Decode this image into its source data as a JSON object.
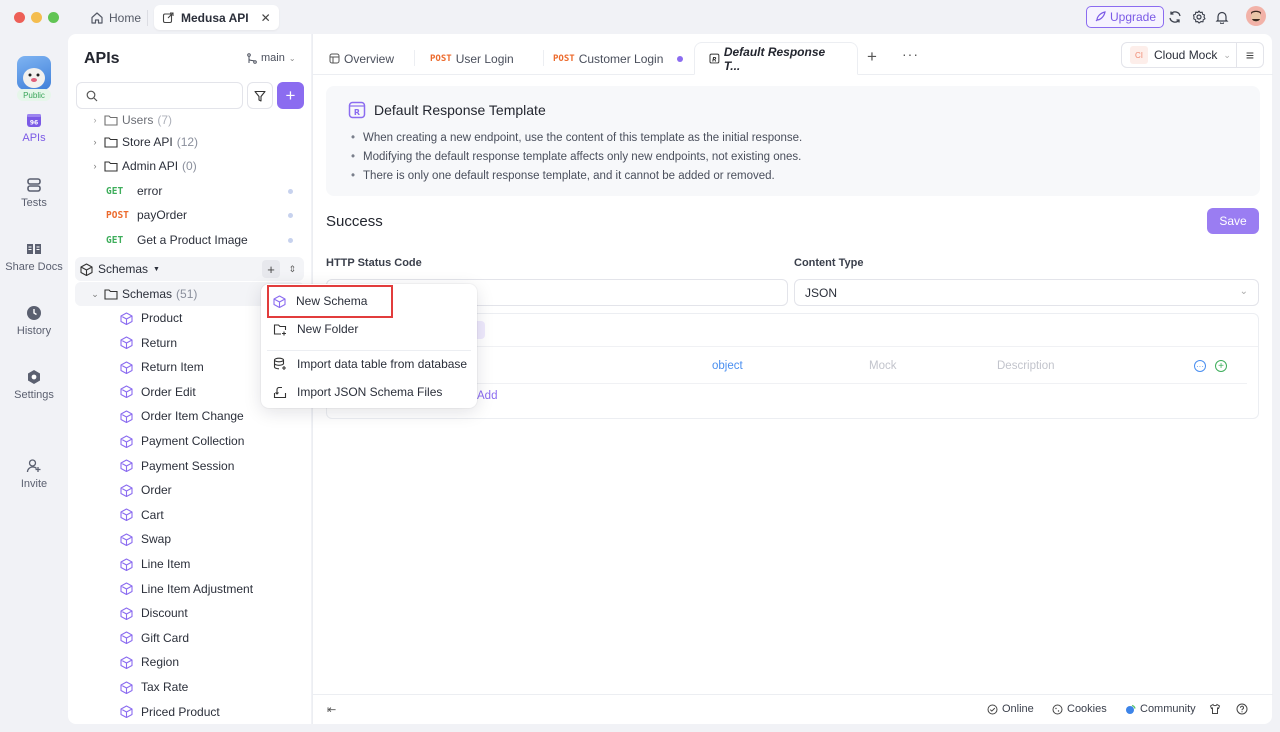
{
  "titlebar": {
    "home_label": "Home",
    "project_tab_label": "Medusa API",
    "upgrade_label": "Upgrade"
  },
  "rail": {
    "public_badge": "Public",
    "items": [
      {
        "label": "APIs",
        "icon": "apis-icon",
        "active": true
      },
      {
        "label": "Tests",
        "icon": "tests-icon"
      },
      {
        "label": "Share Docs",
        "icon": "share-docs-icon"
      },
      {
        "label": "History",
        "icon": "history-icon"
      },
      {
        "label": "Settings",
        "icon": "settings-icon"
      },
      {
        "label": "Invite",
        "icon": "invite-icon"
      }
    ]
  },
  "sidebar": {
    "title": "APIs",
    "branch": "main",
    "search_placeholder": "",
    "tree": [
      {
        "type": "folder",
        "label": "Users",
        "count": "(7)"
      },
      {
        "type": "folder",
        "label": "Store API",
        "count": "(12)"
      },
      {
        "type": "folder",
        "label": "Admin API",
        "count": "(0)"
      },
      {
        "type": "endpoint",
        "method": "GET",
        "label": "error"
      },
      {
        "type": "endpoint",
        "method": "POST",
        "label": "payOrder"
      },
      {
        "type": "endpoint",
        "method": "GET",
        "label": "Get a Product Image"
      }
    ],
    "schemas_header": "Schemas",
    "schemas_folder": {
      "label": "Schemas",
      "count": "(51)"
    },
    "schemas": [
      "Product",
      "Return",
      "Return Item",
      "Order Edit",
      "Order Item Change",
      "Payment Collection",
      "Payment Session",
      "Order",
      "Cart",
      "Swap",
      "Line Item",
      "Line Item Adjustment",
      "Discount",
      "Gift Card",
      "Region",
      "Tax Rate",
      "Priced Product"
    ]
  },
  "tabs": [
    {
      "label": "Overview",
      "method": ""
    },
    {
      "label": "User Login",
      "method": "POST"
    },
    {
      "label": "Customer Login",
      "method": "POST",
      "unsaved": true
    },
    {
      "label": "Default Response T...",
      "method": "",
      "active": true
    }
  ],
  "environment": {
    "badge": "CI",
    "label": "Cloud Mock"
  },
  "info": {
    "title": "Default Response Template",
    "bullets": [
      "When creating a new endpoint, use the content of this template as the initial response.",
      "Modifying the default response template affects only new endpoints, not existing ones.",
      "There is only one default response template, and it cannot be added or removed."
    ]
  },
  "response": {
    "section_title": "Success",
    "save_label": "Save",
    "status_code_label": "HTTP Status Code",
    "status_code_value": "",
    "content_type_label": "Content Type",
    "content_type_value": "JSON",
    "root_type": "object",
    "mock_placeholder": "Mock",
    "description_placeholder": "Description",
    "add_label": "Add"
  },
  "dropdown": {
    "items": [
      {
        "label": "New Schema",
        "icon": "schema-icon",
        "highlighted": true
      },
      {
        "label": "New Folder",
        "icon": "new-folder-icon"
      },
      {
        "label": "Import data table from database",
        "icon": "database-import-icon"
      },
      {
        "label": "Import JSON Schema Files",
        "icon": "file-import-icon"
      }
    ]
  },
  "footer": {
    "online": "Online",
    "cookies": "Cookies",
    "community": "Community"
  },
  "colors": {
    "accent": "#8b6cf0",
    "get": "#3fae5c",
    "post": "#ec6a2c",
    "highlight": "#e23c3c"
  }
}
